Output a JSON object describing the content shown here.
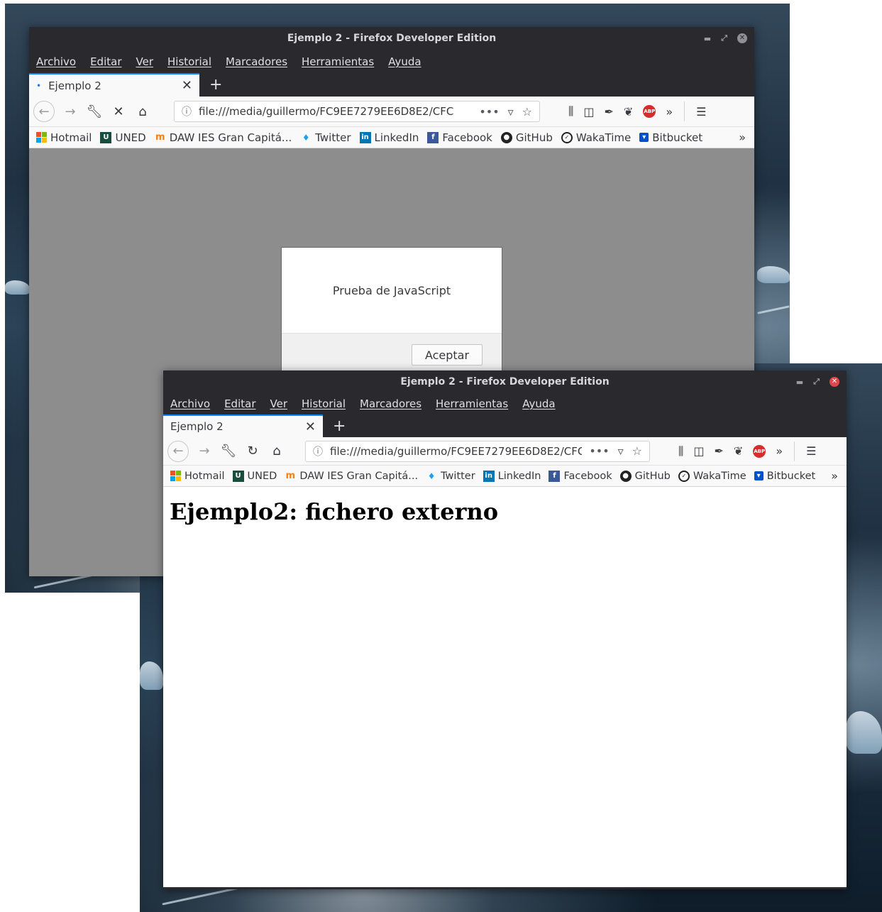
{
  "windows": {
    "back": {
      "title": "Ejemplo 2 - Firefox Developer Edition",
      "menu": [
        "Archivo",
        "Editar",
        "Ver",
        "Historial",
        "Marcadores",
        "Herramientas",
        "Ayuda"
      ],
      "tab": {
        "label": "Ejemplo 2",
        "loading": true
      },
      "url": "file:///media/guillermo/FC9EE7279EE6D8E2/CFC",
      "dialog": {
        "message": "Prueba de JavaScript",
        "ok_label": "Aceptar"
      }
    },
    "front": {
      "title": "Ejemplo 2 - Firefox Developer Edition",
      "menu": [
        "Archivo",
        "Editar",
        "Ver",
        "Historial",
        "Marcadores",
        "Herramientas",
        "Ayuda"
      ],
      "tab": {
        "label": "Ejemplo 2"
      },
      "url": "file:///media/guillermo/FC9EE7279EE6D8E2/CFC",
      "page_heading": "Ejemplo2: fichero externo"
    }
  },
  "bookmarks": [
    "Hotmail",
    "UNED",
    "DAW IES Gran Capitá...",
    "Twitter",
    "LinkedIn",
    "Facebook",
    "GitHub",
    "WakaTime",
    "Bitbucket"
  ],
  "icons": {
    "back": "arrow-left",
    "forward": "arrow-right",
    "tools": "wrench",
    "stop": "x",
    "reload": "reload",
    "home": "home",
    "info": "info-circle",
    "more": "ellipsis",
    "pocket": "pocket",
    "star": "star",
    "library": "library",
    "sidebar": "sidebar",
    "eyedropper": "eyedropper",
    "evernote": "elephant",
    "adblock": "abp",
    "overflow": "chevron-double-right",
    "hamburger": "menu"
  },
  "colors": {
    "accent": "#0a84ff",
    "chrome": "#2a2a2e",
    "toolbar": "#f9f9fa",
    "modal_overlay": "#8d8d8d",
    "close_active": "#e0464b"
  }
}
